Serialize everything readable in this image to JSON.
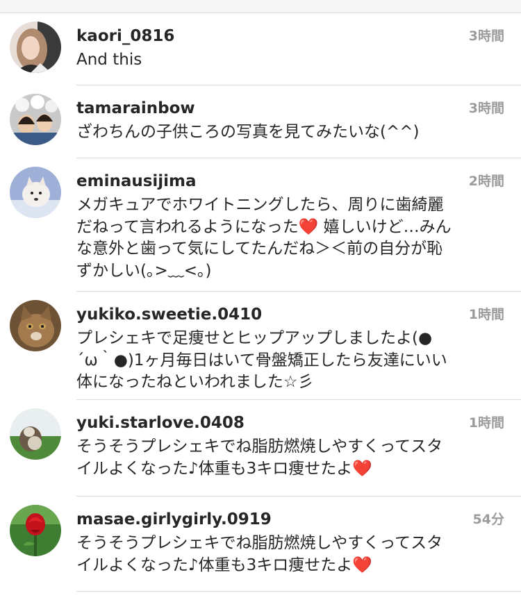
{
  "comments": [
    {
      "username": "kaori_0816",
      "time": "3時間",
      "lines": [
        "And this"
      ],
      "avatar_icon": "woman-portrait-avatar"
    },
    {
      "username": "tamarainbow",
      "time": "3時間",
      "lines": [
        "ざわちんの子供ころの写真を見てみたいな(^^)"
      ],
      "avatar_icon": "group-photo-avatar"
    },
    {
      "username": "eminausijima",
      "time": "2時間",
      "lines": [
        "メガキュアでホワイトニングしたら、周りに歯綺麗",
        "だねって言われるようになった❤️ 嬉しいけど…みん",
        "な意外と歯って気にしてたんだね＞＜前の自分が恥",
        "ずかしい(｡>﹏<｡)"
      ],
      "avatar_icon": "white-dog-avatar"
    },
    {
      "username": "yukiko.sweetie.0410",
      "time": "1時間",
      "lines": [
        "プレシェキで足痩せとヒップアップしましたよ(●",
        "´ω｀●)1ヶ月毎日はいて骨盤矯正したら友達にいい",
        "体になったねといわれました☆彡"
      ],
      "avatar_icon": "cat-avatar"
    },
    {
      "username": "yuki.starlove.0408",
      "time": "1時間",
      "lines": [
        "そうそうプレシェキでね脂肪燃焼しやすくってスタ",
        "イルよくなった♪体重も3キロ痩せたよ❤️"
      ],
      "avatar_icon": "animal-grass-avatar"
    },
    {
      "username": "masae.girlygirly.0919",
      "time": "54分",
      "lines": [
        "そうそうプレシェキでね脂肪燃焼しやすくってスタ",
        "イルよくなった♪体重も3キロ痩せたよ❤️"
      ],
      "avatar_icon": "red-rose-avatar"
    }
  ]
}
